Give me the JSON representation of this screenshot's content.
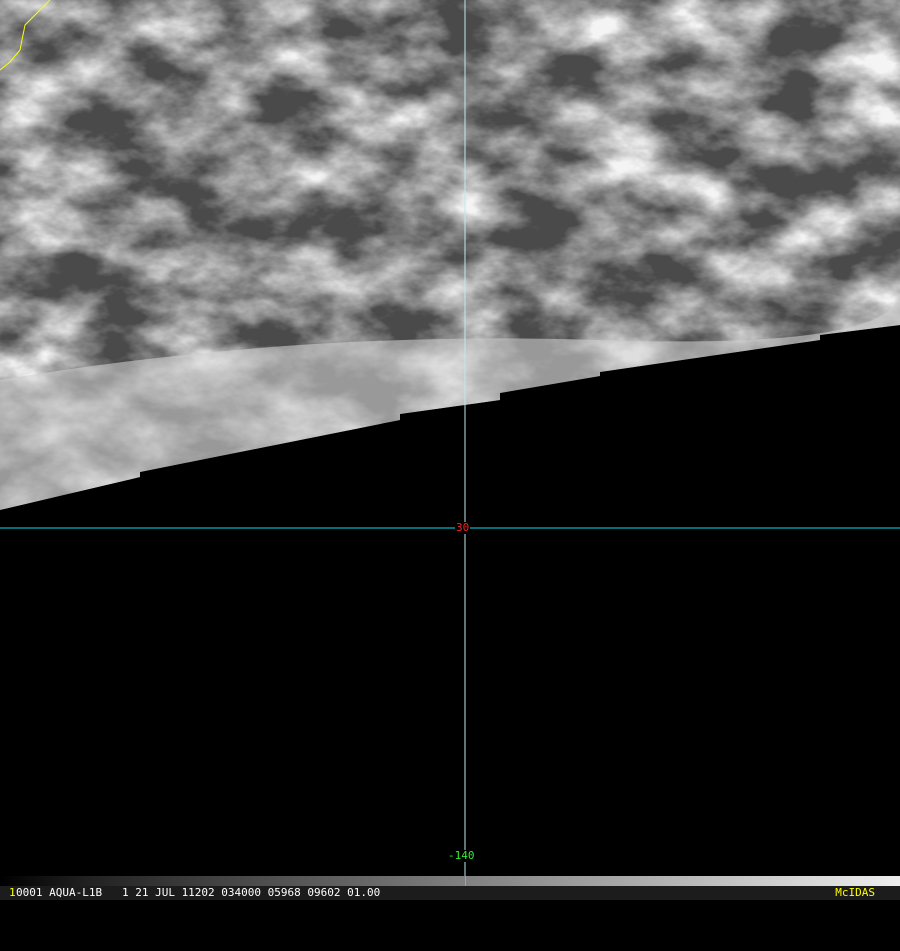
{
  "map": {
    "latitude_label": "30",
    "longitude_label": "-140",
    "colors": {
      "grid": "#00e5ee",
      "lat_label": "#ff2020",
      "lon_label": "#33ee33",
      "coastline": "#ffff00"
    }
  },
  "status_bar": {
    "frame_number": "1",
    "text": "0001 AQUA-L1B   1 21 JUL 11202 034000 05968 09602 01.00",
    "brand": "McIDAS"
  }
}
